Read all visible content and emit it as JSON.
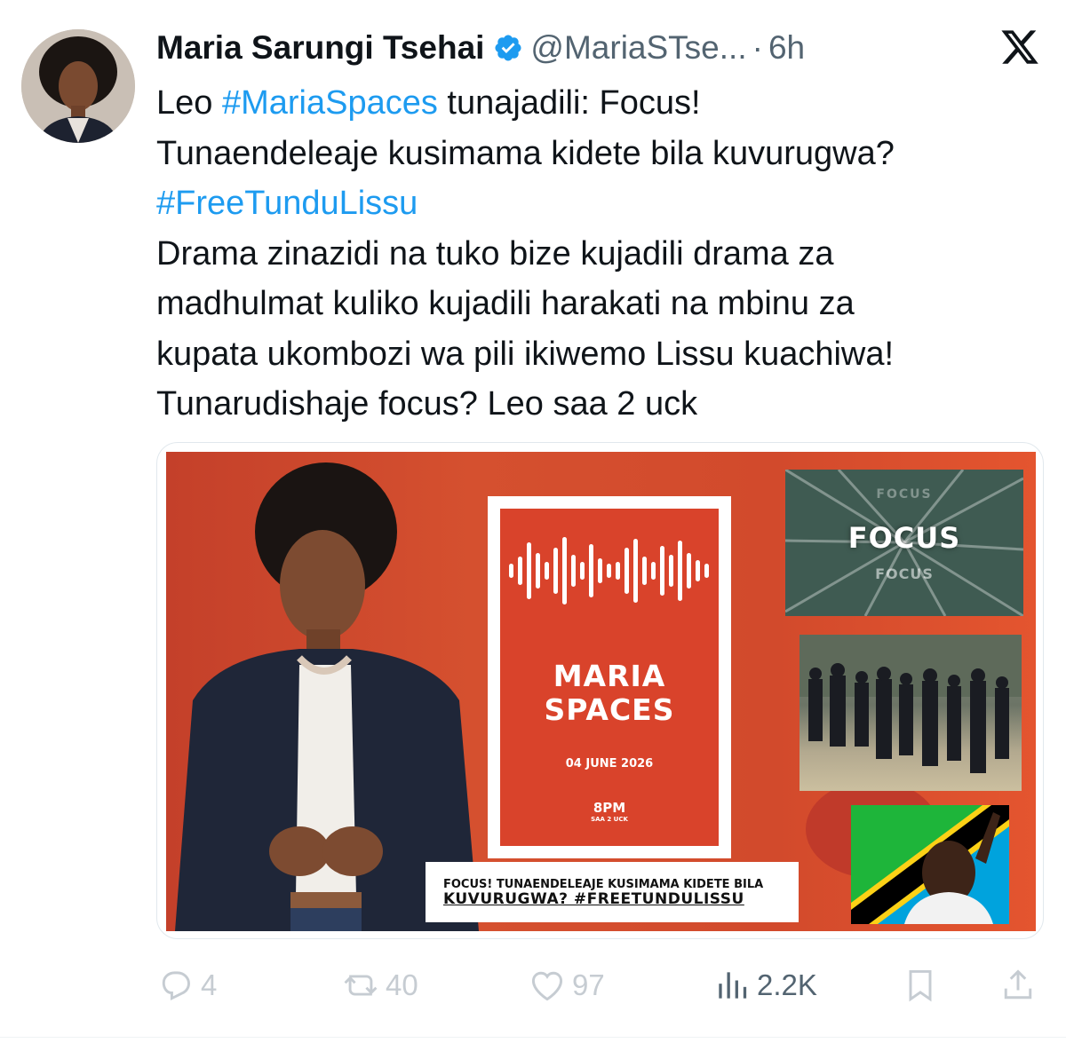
{
  "tweet": {
    "author_name": "Maria Sarungi Tsehai",
    "handle": "@MariaSTse...",
    "separator": "·",
    "time": "6h",
    "lines": [
      {
        "pre": "Leo ",
        "tag": "#MariaSpaces",
        "post": " tunajadili: Focus!"
      },
      {
        "pre": "Tunaendeleaje kusimama kidete bila kuvurugwa?",
        "tag": "",
        "post": ""
      },
      {
        "pre": "",
        "tag": "#FreeTunduLissu",
        "post": ""
      },
      {
        "pre": "Drama zinazidi na tuko bize kujadili drama za",
        "tag": "",
        "post": ""
      },
      {
        "pre": "madhulmat kuliko kujadili harakati na mbinu  za",
        "tag": "",
        "post": ""
      },
      {
        "pre": "kupata ukombozi wa pili ikiwemo Lissu kuachiwa!",
        "tag": "",
        "post": ""
      },
      {
        "pre": "Tunarudishaje focus? Leo saa 2 uck",
        "tag": "",
        "post": ""
      }
    ]
  },
  "poster": {
    "title_line1": "MARIA",
    "title_line2": "SPACES",
    "date": "04 JUNE 2026",
    "time": "8PM",
    "time_sub": "SAA 2 UCK",
    "focus_word": "FOCUS",
    "focus_echo": "FOCUS",
    "caption_line1": "FOCUS! TUNAENDELEAJE KUSIMAMA KIDETE BILA",
    "caption_line2": "KUVURUGWA? #FREETUNDULISSU"
  },
  "actions": {
    "replies": "4",
    "reposts": "40",
    "likes": "97",
    "views": "2.2K"
  },
  "colors": {
    "link": "#1d9bf0",
    "text": "#0f1419",
    "muted": "#536471",
    "poster_red": "#d24a2c"
  },
  "icons": [
    "verified-badge-icon",
    "x-logo-icon",
    "reply-icon",
    "repost-icon",
    "like-icon",
    "views-icon",
    "bookmark-icon",
    "share-icon"
  ]
}
